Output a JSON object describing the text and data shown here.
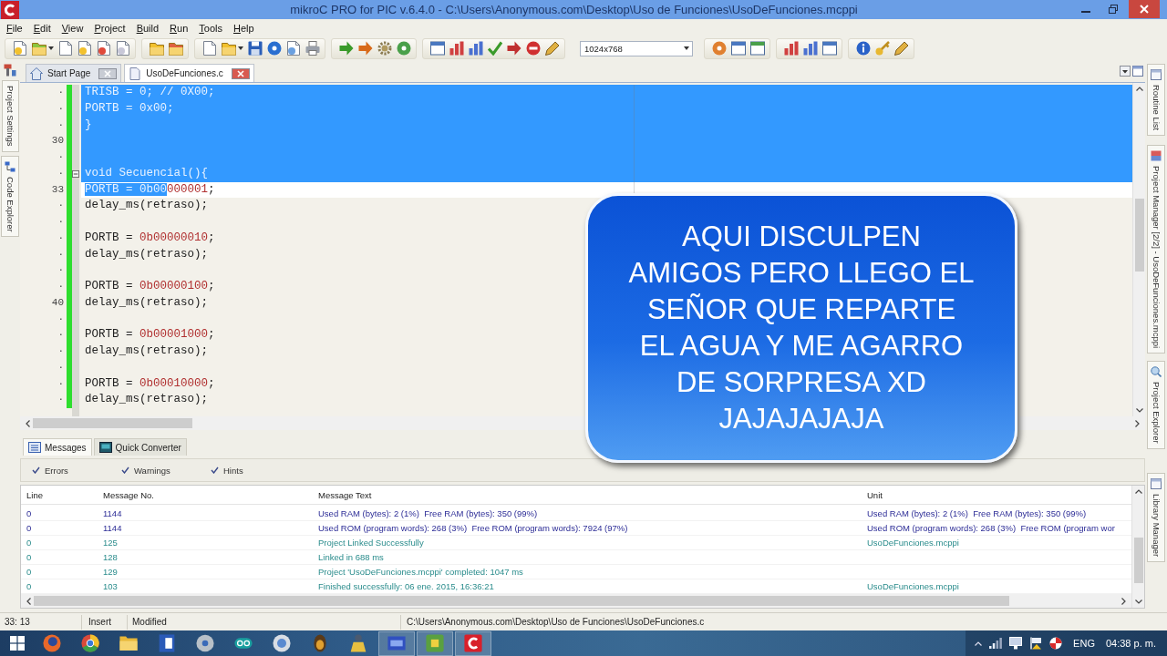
{
  "window": {
    "title": "mikroC PRO for PIC v.6.4.0 - C:\\Users\\Anonymous.com\\Desktop\\Uso de Funciones\\UsoDeFunciones.mcppi"
  },
  "menu": [
    "File",
    "Edit",
    "View",
    "Project",
    "Build",
    "Run",
    "Tools",
    "Help"
  ],
  "toolbar": {
    "resolution": "1024x768"
  },
  "editor_tabs": [
    {
      "label": "Start Page",
      "selected": false
    },
    {
      "label": "UsoDeFunciones.c",
      "selected": true
    }
  ],
  "left_panels": [
    {
      "label": "Project Settings"
    },
    {
      "label": "Code Explorer"
    }
  ],
  "right_panels": [
    {
      "label": "Routine List"
    },
    {
      "label": "Project Manager [2/2] - UsoDeFunciones.mcppi"
    },
    {
      "label": "Project Explorer"
    },
    {
      "label": "Library Manager"
    }
  ],
  "editor": {
    "lines": [
      {
        "number": "·",
        "modified": true,
        "current": false,
        "selected": true,
        "tokens": [
          {
            "text": "TRISB = 0; // 0X00;",
            "kind": "plain",
            "selected": true
          }
        ]
      },
      {
        "number": "·",
        "modified": true,
        "current": false,
        "selected": true,
        "tokens": [
          {
            "text": "PORTB = 0x00;",
            "kind": "plain",
            "selected": true
          }
        ]
      },
      {
        "number": "·",
        "modified": true,
        "current": false,
        "selected": true,
        "tokens": [
          {
            "text": "}",
            "kind": "plain",
            "selected": true
          }
        ]
      },
      {
        "number": "30",
        "modified": true,
        "current": false,
        "selected": true
      },
      {
        "number": "·",
        "modified": true,
        "current": false,
        "selected": true
      },
      {
        "number": "·",
        "modified": true,
        "current": false,
        "selected": true,
        "expanded": true,
        "tokens": [
          {
            "text": "void Secuencial(){",
            "kind": "plain",
            "selected": true
          }
        ]
      },
      {
        "number": "33",
        "modified": true,
        "current": true,
        "selected": false,
        "tokens": [
          {
            "text": "PORTB = ",
            "kind": "plain",
            "selected": true
          },
          {
            "text": "0b00",
            "kind": "number",
            "selected": true
          },
          {
            "text": "000001",
            "kind": "number",
            "selected": false
          },
          {
            "text": ";",
            "kind": "plain",
            "selected": false
          }
        ]
      },
      {
        "number": "·",
        "modified": true,
        "current": false,
        "selected": false,
        "tokens": [
          {
            "text": "delay_ms(retraso);",
            "kind": "plain",
            "selected": false
          }
        ]
      },
      {
        "number": "·",
        "modified": true,
        "current": false,
        "selected": false
      },
      {
        "number": "·",
        "modified": true,
        "current": false,
        "selected": false,
        "tokens": [
          {
            "text": "PORTB = ",
            "kind": "plain",
            "selected": false
          },
          {
            "text": "0b00000010",
            "kind": "number",
            "selected": false
          },
          {
            "text": ";",
            "kind": "plain",
            "selected": false
          }
        ]
      },
      {
        "number": "·",
        "modified": true,
        "current": false,
        "selected": false,
        "tokens": [
          {
            "text": "delay_ms(retraso);",
            "kind": "plain",
            "selected": false
          }
        ]
      },
      {
        "number": "·",
        "modified": true,
        "current": false,
        "selected": false
      },
      {
        "number": "·",
        "modified": true,
        "current": false,
        "selected": false,
        "tokens": [
          {
            "text": "PORTB = ",
            "kind": "plain",
            "selected": false
          },
          {
            "text": "0b00000100",
            "kind": "number",
            "selected": false
          },
          {
            "text": ";",
            "kind": "plain",
            "selected": false
          }
        ]
      },
      {
        "number": "40",
        "modified": true,
        "current": false,
        "selected": false,
        "tokens": [
          {
            "text": "delay_ms(retraso);",
            "kind": "plain",
            "selected": false
          }
        ]
      },
      {
        "number": "·",
        "modified": true,
        "current": false,
        "selected": false
      },
      {
        "number": "·",
        "modified": true,
        "current": false,
        "selected": false,
        "tokens": [
          {
            "text": "PORTB = ",
            "kind": "plain",
            "selected": false
          },
          {
            "text": "0b00001000",
            "kind": "number",
            "selected": false
          },
          {
            "text": ";",
            "kind": "plain",
            "selected": false
          }
        ]
      },
      {
        "number": "·",
        "modified": true,
        "current": false,
        "selected": false,
        "tokens": [
          {
            "text": "delay_ms(retraso);",
            "kind": "plain",
            "selected": false
          }
        ]
      },
      {
        "number": "·",
        "modified": true,
        "current": false,
        "selected": false
      },
      {
        "number": "·",
        "modified": true,
        "current": false,
        "selected": false,
        "tokens": [
          {
            "text": "PORTB = ",
            "kind": "plain",
            "selected": false
          },
          {
            "text": "0b00010000",
            "kind": "number",
            "selected": false
          },
          {
            "text": ";",
            "kind": "plain",
            "selected": false
          }
        ]
      },
      {
        "number": "·",
        "modified": true,
        "current": false,
        "selected": false,
        "tokens": [
          {
            "text": "delay_ms(retraso);",
            "kind": "plain",
            "selected": false
          }
        ]
      }
    ]
  },
  "caption": {
    "lines": [
      "AQUI DISCULPEN",
      "AMIGOS PERO LLEGO EL",
      "SEÑOR QUE REPARTE",
      "EL AGUA Y ME AGARRO",
      "DE SORPRESA XD",
      "JAJAJAJAJA"
    ]
  },
  "messages": {
    "tabs": [
      {
        "label": "Messages",
        "selected": true
      },
      {
        "label": "Quick Converter",
        "selected": false
      }
    ],
    "filters": [
      {
        "label": "Errors",
        "checked": true
      },
      {
        "label": "Warnings",
        "checked": true
      },
      {
        "label": "Hints",
        "checked": true
      }
    ],
    "columns": [
      "Line",
      "Message No.",
      "Message Text",
      "Unit"
    ],
    "rows": [
      {
        "kind": "hint",
        "line": "0",
        "number": "1144",
        "text": "Used RAM (bytes): 2 (1%)  Free RAM (bytes): 350 (99%)",
        "unit": "Used RAM (bytes): 2 (1%)  Free RAM (bytes): 350 (99%)"
      },
      {
        "kind": "hint",
        "line": "0",
        "number": "1144",
        "text": "Used ROM (program words): 268 (3%)  Free ROM (program words): 7924 (97%)",
        "unit": "Used ROM (program words): 268 (3%)  Free ROM (program wor"
      },
      {
        "kind": "info",
        "line": "0",
        "number": "125",
        "text": "Project Linked Successfully",
        "unit": "UsoDeFunciones.mcppi"
      },
      {
        "kind": "info",
        "line": "0",
        "number": "128",
        "text": "Linked in 688 ms"
      },
      {
        "kind": "info",
        "line": "0",
        "number": "129",
        "text": "Project 'UsoDeFunciones.mcppi' completed: 1047 ms"
      },
      {
        "kind": "info",
        "line": "0",
        "number": "103",
        "text": "Finished successfully: 06 ene. 2015, 16:36:21",
        "unit": "UsoDeFunciones.mcppi"
      }
    ]
  },
  "status_bar": {
    "position": "33: 13",
    "mode": "Insert",
    "state": "Modified",
    "path": "C:\\Users\\Anonymous.com\\Desktop\\Uso de Funciones\\UsoDeFunciones.c"
  },
  "taskbar": {
    "apps": [
      {
        "kind": "globe",
        "running": false
      },
      {
        "kind": "wheel",
        "running": false
      },
      {
        "kind": "folder",
        "running": false
      },
      {
        "kind": "window",
        "running": false
      },
      {
        "kind": "disc",
        "running": false
      },
      {
        "kind": "oval",
        "running": false
      },
      {
        "kind": "circle",
        "running": false
      },
      {
        "kind": "beetle",
        "running": false
      },
      {
        "kind": "figure",
        "running": false
      },
      {
        "kind": "board",
        "running": true
      },
      {
        "kind": "chip",
        "running": true
      },
      {
        "kind": "logo",
        "running": true
      }
    ],
    "language": "ENG",
    "time": "04:38 p. m."
  }
}
